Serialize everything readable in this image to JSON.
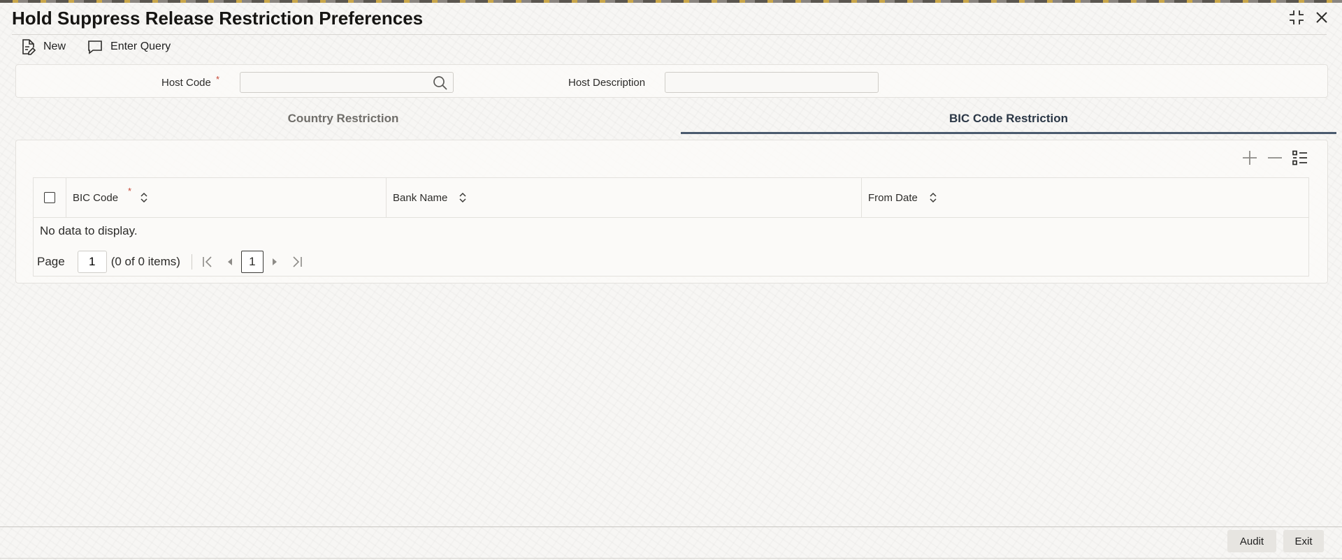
{
  "window": {
    "title": "Hold Suppress Release Restriction Preferences"
  },
  "toolbar": {
    "new_label": "New",
    "enter_query_label": "Enter Query"
  },
  "header": {
    "host_code_label": "Host Code",
    "host_code_required": "*",
    "host_code_value": "",
    "host_description_label": "Host Description",
    "host_description_value": ""
  },
  "tabs": [
    {
      "label": "Country Restriction",
      "active": false
    },
    {
      "label": "BIC Code Restriction",
      "active": true
    }
  ],
  "grid": {
    "columns": [
      {
        "label": "BIC Code",
        "required": "*"
      },
      {
        "label": "Bank Name"
      },
      {
        "label": "From Date"
      }
    ],
    "rows": [],
    "empty_message": "No data to display.",
    "pager": {
      "page_label": "Page",
      "page_value": "1",
      "items_text": "(0 of 0 items)",
      "current_page": "1"
    }
  },
  "footer": {
    "audit_label": "Audit",
    "exit_label": "Exit"
  },
  "icons": {
    "new": "new-document-icon",
    "enter_query": "speech-bubble-icon",
    "search": "search-icon",
    "add_row": "plus-icon",
    "delete_row": "minus-icon",
    "single_view": "list-view-icon",
    "sort": "sort-icon",
    "first": "first-page-icon",
    "prev": "previous-page-icon",
    "next": "next-page-icon",
    "last": "last-page-icon",
    "minimize": "collapse-icon",
    "close": "close-icon"
  },
  "colors": {
    "required": "#c74634",
    "active_tab_underline": "#4a5a6e",
    "background": "#f7f6f4"
  }
}
